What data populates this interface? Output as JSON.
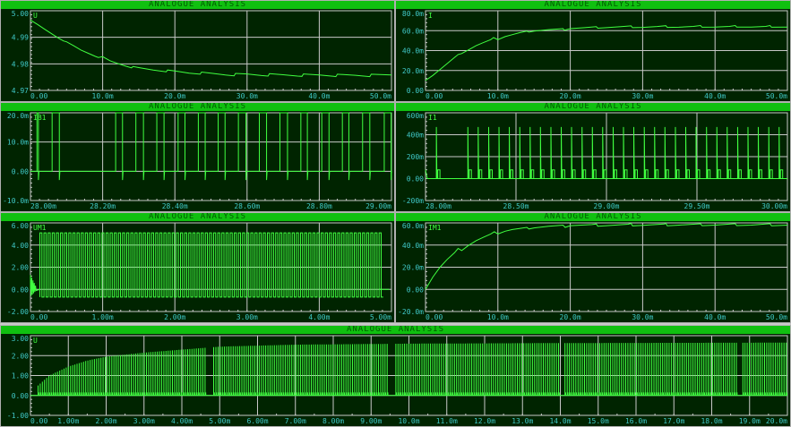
{
  "window_title": "ANALOGUE ANALYSIS",
  "colors": {
    "background": "#002400",
    "title_bar": "#10c010",
    "title_text": "#005a00",
    "grid": "#c8c8c8",
    "trace": "#40ff40",
    "tick_label": "#40c8c8"
  },
  "chart_data": [
    {
      "id": "u-top-left",
      "type": "line",
      "title": "ANALOGUE ANALYSIS",
      "trace_label": "U",
      "xlim": [
        0,
        50
      ],
      "ylim": [
        4.97,
        5.0
      ],
      "grid": true,
      "xticks": [
        0,
        10,
        20,
        30,
        40,
        50
      ],
      "xtick_labels": [
        "0.00",
        "10.0m",
        "20.0m",
        "30.0m",
        "40.0m",
        "50.0m"
      ],
      "yticks": [
        4.97,
        4.98,
        4.99,
        5.0
      ],
      "ytick_labels": [
        "4.97",
        "4.98",
        "4.99",
        "5.00"
      ],
      "series": [
        {
          "x": [
            0,
            1,
            2,
            3,
            4,
            4.6,
            5,
            6,
            7,
            8,
            9,
            9.4,
            10,
            11,
            12,
            13,
            14,
            14.2,
            15,
            17,
            18.8,
            19,
            20,
            22,
            23.5,
            23.7,
            25,
            27,
            28.2,
            28.4,
            30,
            32,
            32.9,
            33.1,
            35,
            37,
            37.6,
            37.8,
            40,
            42,
            42.3,
            42.5,
            45,
            47,
            47,
            47.2,
            50
          ],
          "y": [
            4.9965,
            4.9948,
            4.993,
            4.9912,
            4.9895,
            4.9886,
            4.9883,
            4.9868,
            4.9852,
            4.984,
            4.9828,
            4.9824,
            4.9827,
            4.9812,
            4.9802,
            4.9793,
            4.9785,
            4.979,
            4.9786,
            4.9777,
            4.977,
            4.9777,
            4.9773,
            4.9765,
            4.9761,
            4.9769,
            4.9765,
            4.9758,
            4.9755,
            4.9764,
            4.9762,
            4.9756,
            4.9754,
            4.9763,
            4.9759,
            4.9754,
            4.9753,
            4.9762,
            4.9758,
            4.9753,
            4.9752,
            4.9761,
            4.9757,
            4.9752,
            4.9752,
            4.9761,
            4.9758
          ]
        }
      ]
    },
    {
      "id": "i-top-right",
      "type": "line",
      "title": "ANALOGUE ANALYSIS",
      "trace_label": "I",
      "xlim": [
        0,
        50
      ],
      "ylim": [
        0,
        80
      ],
      "grid": true,
      "xticks": [
        0,
        10,
        20,
        30,
        40,
        50
      ],
      "xtick_labels": [
        "0.00",
        "10.0m",
        "20.0m",
        "30.0m",
        "40.0m",
        "50.0m"
      ],
      "yticks": [
        0,
        20,
        40,
        60,
        80
      ],
      "ytick_labels": [
        "0.00",
        "20.0m",
        "40.0m",
        "60.0m",
        "80.0m"
      ],
      "series": [
        {
          "x": [
            0,
            1,
            2,
            3,
            4,
            4.5,
            5,
            6,
            7,
            8,
            9,
            9.4,
            10,
            11,
            12,
            13,
            14,
            14.3,
            15,
            17,
            19,
            19.2,
            20,
            22,
            23.6,
            23.8,
            25,
            27,
            28.4,
            28.6,
            30,
            32,
            33.2,
            33.4,
            35,
            37,
            38,
            38.2,
            40,
            42,
            42.8,
            43,
            45,
            47,
            47.6,
            47.8,
            50
          ],
          "y": [
            10,
            15,
            21,
            27,
            33,
            36,
            37,
            41,
            45,
            48,
            51,
            53,
            51,
            54,
            56,
            58,
            59.5,
            58.5,
            59.5,
            61,
            62,
            60.5,
            62,
            63,
            64,
            62.5,
            63,
            64,
            64.8,
            63,
            63.3,
            64.2,
            65,
            63.3,
            63.5,
            64.3,
            65.2,
            63.5,
            63.6,
            64.3,
            65.2,
            63.6,
            63.6,
            64.3,
            65.2,
            63.5,
            63.6
          ]
        }
      ]
    },
    {
      "id": "ib1-mid-left",
      "type": "line",
      "title": "ANALOGUE ANALYSIS",
      "trace_label": "IB1",
      "xlim": [
        28.0,
        29.0
      ],
      "ylim": [
        -10,
        20
      ],
      "grid": true,
      "xticks": [
        28.0,
        28.2,
        28.4,
        28.6,
        28.8,
        29.0
      ],
      "xtick_labels": [
        "28.00m",
        "28.20m",
        "28.40m",
        "28.60m",
        "28.80m",
        "29.00m"
      ],
      "yticks": [
        -10,
        0,
        10,
        20
      ],
      "ytick_labels": [
        "-10.0m",
        "0.00",
        "10.0m",
        "20.0m"
      ],
      "pulse_series": {
        "baseline": 0,
        "high": 20,
        "undershoot": -3,
        "pulses": [
          [
            28.018,
            28.022
          ],
          [
            28.06,
            28.08
          ],
          [
            28.236,
            28.255
          ],
          [
            28.292,
            28.313
          ],
          [
            28.35,
            28.37
          ],
          [
            28.409,
            28.428
          ],
          [
            28.465,
            28.484
          ],
          [
            28.52,
            28.539
          ],
          [
            28.576,
            28.597
          ],
          [
            28.634,
            28.654
          ],
          [
            28.691,
            28.712
          ],
          [
            28.749,
            28.767
          ],
          [
            28.807,
            28.827
          ],
          [
            28.864,
            28.882
          ],
          [
            28.92,
            28.94
          ],
          [
            28.98,
            28.999
          ]
        ]
      }
    },
    {
      "id": "i1-mid-right",
      "type": "line",
      "title": "ANALOGUE ANALYSIS",
      "trace_label": "I1",
      "xlim": [
        28.0,
        30.0
      ],
      "ylim": [
        -200,
        600
      ],
      "grid": true,
      "xticks": [
        28.0,
        28.5,
        29.0,
        29.5,
        30.0
      ],
      "xtick_labels": [
        "28.00m",
        "28.50m",
        "29.00m",
        "29.50m",
        "30.00m"
      ],
      "yticks": [
        -200,
        0,
        200,
        400,
        600
      ],
      "ytick_labels": [
        "-200m",
        "0.00",
        "200m",
        "400m",
        "600m"
      ],
      "spike_series": {
        "baseline": 0,
        "spike": 470,
        "step": 80,
        "times": [
          28.06,
          28.234,
          28.291,
          28.349,
          28.406,
          28.463,
          28.521,
          28.578,
          28.635,
          28.693,
          28.75,
          28.807,
          28.865,
          28.922,
          28.979,
          29.037,
          29.094,
          29.151,
          29.209,
          29.266,
          29.323,
          29.381,
          29.438,
          29.495,
          29.553,
          29.61,
          29.667,
          29.725,
          29.782,
          29.839,
          29.897,
          29.954
        ]
      }
    },
    {
      "id": "um1-lower-left",
      "type": "line",
      "title": "ANALOGUE ANALYSIS",
      "trace_label": "UM1",
      "xlim": [
        0,
        5
      ],
      "ylim": [
        -2,
        6
      ],
      "grid": true,
      "xticks": [
        0,
        1,
        2,
        3,
        4,
        5
      ],
      "xtick_labels": [
        "0.00",
        "1.00m",
        "2.00m",
        "3.00m",
        "4.00m",
        "5.00m"
      ],
      "yticks": [
        -2,
        0,
        2,
        4,
        6
      ],
      "ytick_labels": [
        "-2.00",
        "0.00",
        "2.00",
        "4.00",
        "6.00"
      ],
      "square_series": {
        "start": 0.13,
        "period": 0.0573,
        "duty": 0.5,
        "high": 5.1,
        "low": -0.7,
        "idle": 0,
        "gap": [
          4.83,
          4.97
        ],
        "end": 5.0
      }
    },
    {
      "id": "im1-lower-right",
      "type": "line",
      "title": "ANALOGUE ANALYSIS",
      "trace_label": "IM1",
      "xlim": [
        0,
        50
      ],
      "ylim": [
        -20,
        60
      ],
      "grid": true,
      "xticks": [
        0,
        10,
        20,
        30,
        40,
        50
      ],
      "xtick_labels": [
        "0.00",
        "10.0m",
        "20.0m",
        "30.0m",
        "40.0m",
        "50.0m"
      ],
      "yticks": [
        -20,
        0,
        20,
        40,
        60
      ],
      "ytick_labels": [
        "-20.0m",
        "0.00",
        "20.0m",
        "40.0m",
        "60.0m"
      ],
      "series": [
        {
          "x": [
            0,
            1,
            2,
            3,
            4,
            4.5,
            5,
            6,
            7,
            8,
            9,
            9.5,
            10,
            11,
            12,
            13,
            14,
            14.3,
            15,
            17,
            19,
            19.3,
            20,
            23,
            23.6,
            23.8,
            25,
            28,
            28.4,
            28.6,
            30,
            33,
            33.2,
            33.4,
            35,
            38,
            38.2,
            40,
            42.8,
            43,
            45,
            47.6,
            47.8,
            50
          ],
          "y": [
            0,
            11,
            20,
            27,
            33,
            37,
            35,
            40,
            44,
            47,
            50,
            52,
            50,
            52.5,
            54,
            55,
            56,
            54.5,
            55.5,
            57,
            58,
            56,
            57.5,
            58.5,
            59,
            57,
            57.5,
            58.8,
            59.5,
            57.3,
            57.8,
            59,
            59.6,
            57.4,
            58,
            59.2,
            57.5,
            58,
            59.3,
            57.6,
            58,
            59.3,
            57.4,
            58
          ]
        }
      ]
    },
    {
      "id": "u-bottom",
      "type": "line",
      "title": "ANALOGUE ANALYSIS",
      "trace_label": "U",
      "xlim": [
        0,
        20
      ],
      "ylim": [
        -1,
        3
      ],
      "grid": true,
      "xticks": [
        0,
        1,
        2,
        3,
        4,
        5,
        6,
        7,
        8,
        9,
        10,
        11,
        12,
        13,
        14,
        15,
        16,
        17,
        18,
        19,
        20
      ],
      "xtick_labels": [
        "0.00",
        "1.00m",
        "2.00m",
        "3.00m",
        "4.00m",
        "5.00m",
        "6.00m",
        "7.00m",
        "8.00m",
        "9.00m",
        "10.0m",
        "11.0m",
        "12.0m",
        "13.0m",
        "14.0m",
        "15.0m",
        "16.0m",
        "17.0m",
        "18.0m",
        "19.0m",
        "20.0m"
      ],
      "yticks": [
        -1,
        0,
        1,
        2,
        3
      ],
      "ytick_labels": [
        "-1.00",
        "0.00",
        "1.00",
        "2.00",
        "3.00"
      ],
      "envelope_series": {
        "start": 0.2,
        "period": 0.0573,
        "baseline": 0,
        "ripple": 0.15,
        "envelope_x": [
          0.2,
          0.5,
          1.0,
          1.5,
          2.0,
          3.0,
          4.0,
          5.0,
          7.0,
          10.0,
          14.0,
          20.0
        ],
        "envelope_y": [
          0.5,
          1.0,
          1.45,
          1.75,
          1.95,
          2.15,
          2.3,
          2.45,
          2.55,
          2.6,
          2.63,
          2.65
        ],
        "gaps": [
          [
            4.66,
            4.84
          ],
          [
            9.46,
            9.6
          ],
          [
            13.98,
            14.1
          ],
          [
            18.7,
            18.82
          ]
        ]
      }
    }
  ]
}
